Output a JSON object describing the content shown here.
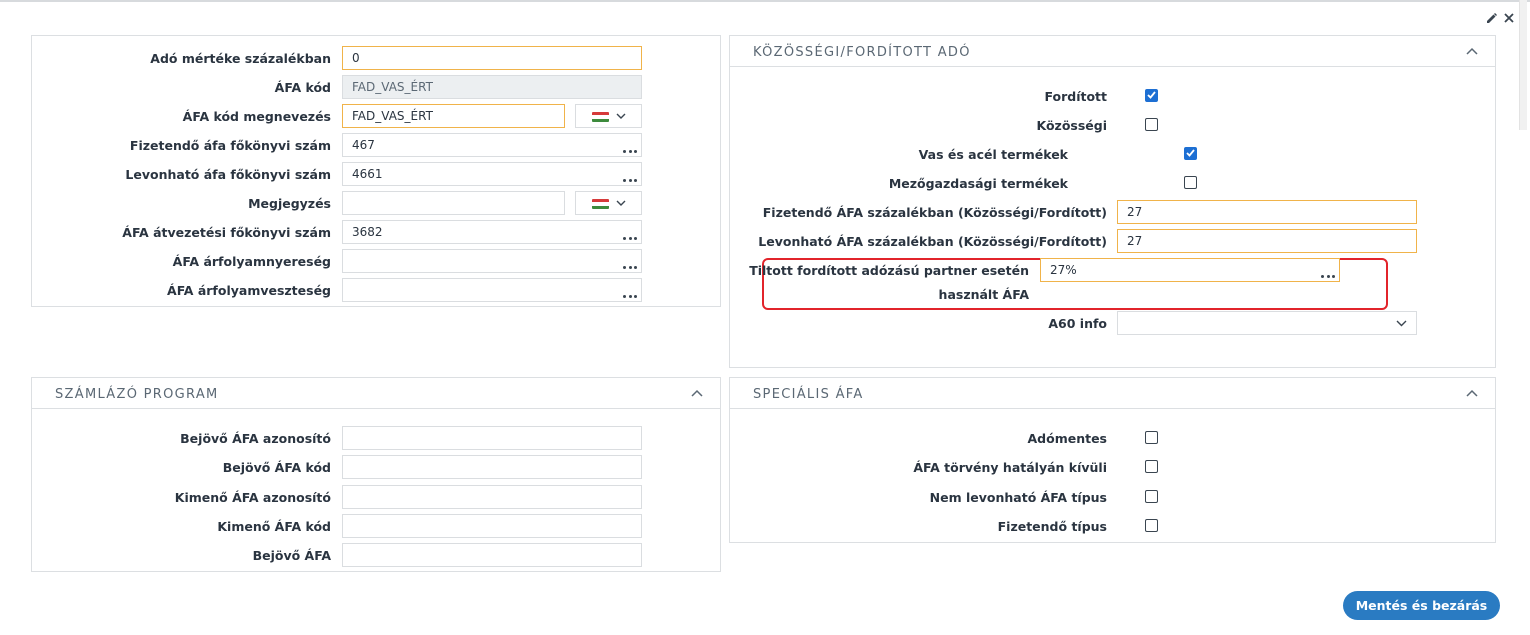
{
  "colors": {
    "accent": "#2a7bc2",
    "checkbox_checked": "#1d6fd3",
    "focus_border": "#f0b34a",
    "highlight": "#e2242b"
  },
  "icons": {
    "edit": "pencil-icon",
    "close": "close-icon",
    "flag": "hungarian-flag-icon",
    "dropdown": "chevron-down-icon",
    "collapse": "chevron-up-icon",
    "lookup": "ellipsis-icon"
  },
  "main_form": {
    "ado_merteke": {
      "label": "Adó mértéke százalékban",
      "value": "0"
    },
    "afa_kod": {
      "label": "ÁFA kód",
      "value": "FAD_VAS_ÉRT"
    },
    "afa_kod_megnevezes": {
      "label": "ÁFA kód megnevezés",
      "value": "FAD_VAS_ÉRT"
    },
    "fizetendo_fokonyv": {
      "label": "Fizetendő áfa főkönyvi szám",
      "value": "467"
    },
    "levonhato_fokonyv": {
      "label": "Levonható áfa főkönyvi szám",
      "value": "4661"
    },
    "megjegyzes": {
      "label": "Megjegyzés",
      "value": ""
    },
    "atvezetesi_fokonyv": {
      "label": "ÁFA átvezetési főkönyvi szám",
      "value": "3682"
    },
    "arfolyamnyereseg": {
      "label": "ÁFA árfolyamnyereség",
      "value": ""
    },
    "arfolyamveszteseg": {
      "label": "ÁFA árfolyamveszteség",
      "value": ""
    }
  },
  "kozossegi": {
    "title": "Közösségi/Fordított adó",
    "forditott": {
      "label": "Fordított",
      "checked": true
    },
    "kozossegi": {
      "label": "Közösségi",
      "checked": false
    },
    "vas_acel": {
      "label": "Vas és acél termékek",
      "checked": true
    },
    "mezogazdasagi": {
      "label": "Mezőgazdasági termékek",
      "checked": false
    },
    "fizetendo_szazalek": {
      "label": "Fizetendő ÁFA százalékban (Közösségi/Fordított)",
      "value": "27"
    },
    "levonhato_szazalek": {
      "label": "Levonható ÁFA százalékban (Közösségi/Fordított)",
      "value": "27"
    },
    "tiltott": {
      "label_line1": "Tiltott fordított adózású partner esetén",
      "label_line2": "használt ÁFA",
      "value": "27%"
    },
    "a60": {
      "label": "A60 info",
      "value": ""
    }
  },
  "szamlazo": {
    "title": "Számlázó program",
    "bejovo_azonosito": {
      "label": "Bejövő ÁFA azonosító",
      "value": ""
    },
    "bejovo_kod": {
      "label": "Bejövő ÁFA kód",
      "value": ""
    },
    "kimeno_azonosito": {
      "label": "Kimenő ÁFA azonosító",
      "value": ""
    },
    "kimeno_kod": {
      "label": "Kimenő ÁFA kód",
      "value": ""
    },
    "bejovo_afa": {
      "label": "Bejövő ÁFA",
      "value": ""
    }
  },
  "specialis": {
    "title": "Speciális ÁFA",
    "adomentes": {
      "label": "Adómentes",
      "checked": false
    },
    "torveny_kivuli": {
      "label": "ÁFA törvény hatályán kívüli",
      "checked": false
    },
    "nem_levonhato": {
      "label": "Nem levonható ÁFA típus",
      "checked": false
    },
    "fizetendo_tipus": {
      "label": "Fizetendő típus",
      "checked": false
    }
  },
  "footer": {
    "save_label": "Mentés és bezárás"
  }
}
